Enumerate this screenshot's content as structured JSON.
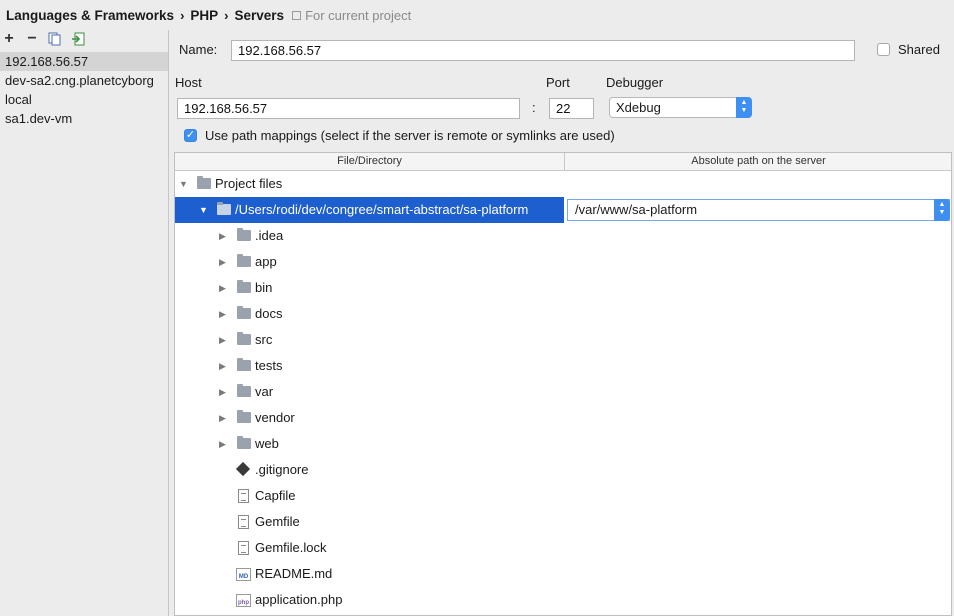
{
  "breadcrumb": {
    "items": [
      "Languages & Frameworks",
      "PHP",
      "Servers"
    ],
    "scope": "For current project"
  },
  "toolbar": {
    "add": "+",
    "remove": "−"
  },
  "servers": [
    "192.168.56.57",
    "dev-sa2.cng.planetcyborg",
    "local",
    "sa1.dev-vm"
  ],
  "selected_server_index": 0,
  "form": {
    "name_label": "Name:",
    "name_value": "192.168.56.57",
    "shared_label": "Shared",
    "shared_checked": false,
    "host_label": "Host",
    "host_value": "192.168.56.57",
    "colon": ":",
    "port_label": "Port",
    "port_value": "22",
    "debugger_label": "Debugger",
    "debugger_value": "Xdebug",
    "path_mappings_label": "Use path mappings (select if the server is remote or symlinks are used)",
    "path_mappings_checked": true
  },
  "table": {
    "col_file": "File/Directory",
    "col_server": "Absolute path on the server",
    "root_label": "Project files",
    "mapped_local": "/Users/rodi/dev/congree/smart-abstract/sa-platform",
    "mapped_server": "/var/www/sa-platform",
    "folders": [
      ".idea",
      "app",
      "bin",
      "docs",
      "src",
      "tests",
      "var",
      "vendor",
      "web"
    ],
    "files": [
      {
        "name": ".gitignore",
        "icon": "git-icon"
      },
      {
        "name": "Capfile",
        "icon": "text-file-icon"
      },
      {
        "name": "Gemfile",
        "icon": "text-file-icon"
      },
      {
        "name": "Gemfile.lock",
        "icon": "text-file-icon"
      },
      {
        "name": "README.md",
        "icon": "markdown-file-icon",
        "badge": "MD"
      },
      {
        "name": "application.php",
        "icon": "php-file-icon",
        "badge": "php"
      }
    ]
  },
  "colors": {
    "selection": "#1e5fd0",
    "accent": "#3d8ff2",
    "panel_bg": "#ececec"
  }
}
